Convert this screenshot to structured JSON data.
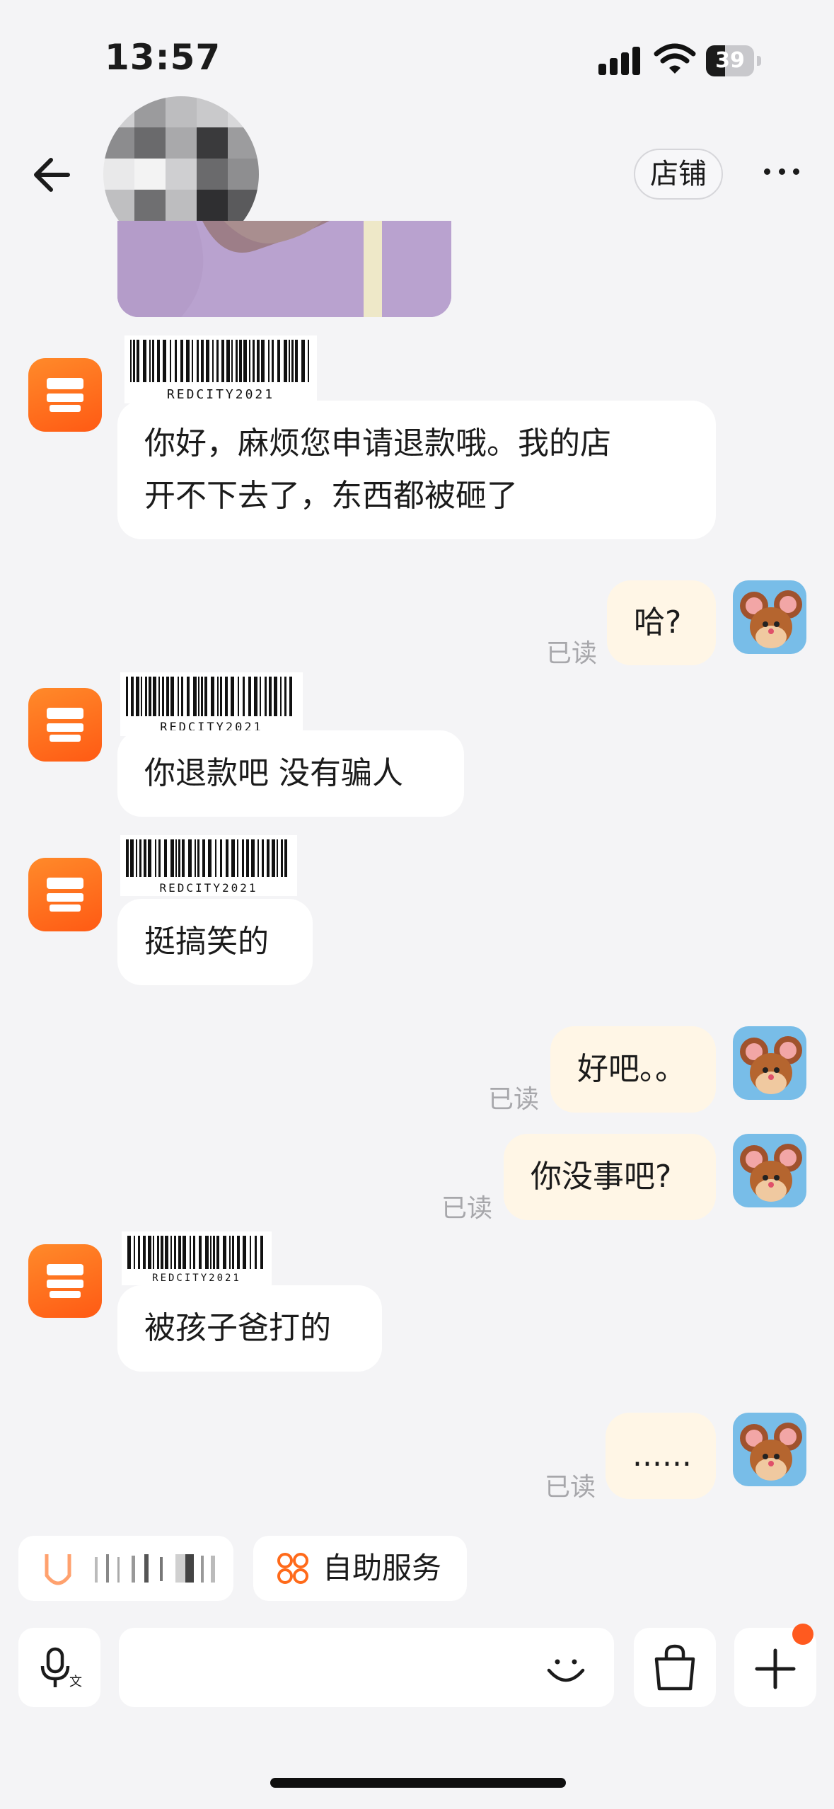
{
  "status_bar": {
    "time": "13:57",
    "battery": "39",
    "battery_level": 0.39
  },
  "header": {
    "store_button": "店铺"
  },
  "barcode_text": "REDCITY2021",
  "messages": [
    {
      "from": "shop",
      "lines": [
        "你好，麻烦您申请退款哦。我的店",
        "开不下去了，东西都被砸了"
      ]
    },
    {
      "from": "me",
      "text": "哈?",
      "status": "已读"
    },
    {
      "from": "shop",
      "text": "你退款吧 没有骗人"
    },
    {
      "from": "shop",
      "text": "挺搞笑的"
    },
    {
      "from": "me",
      "text": "好吧。。",
      "status": "已读"
    },
    {
      "from": "me",
      "text": "你没事吧?",
      "status": "已读"
    },
    {
      "from": "shop",
      "text": "被孩子爸打的"
    },
    {
      "from": "me",
      "text": "......",
      "status": "已读"
    }
  ],
  "quick_actions": {
    "self_service": "自助服务"
  },
  "input": {
    "placeholder": ""
  },
  "colors": {
    "accent": "#ff6a1a",
    "bubble_out": "#fff6e6",
    "notification_dot": "#ff5a1f"
  },
  "icons": [
    "back-arrow-icon",
    "shop-icon",
    "mic-translate-icon",
    "emoji-icon",
    "shopping-bag-icon",
    "plus-icon",
    "self-service-icon"
  ]
}
